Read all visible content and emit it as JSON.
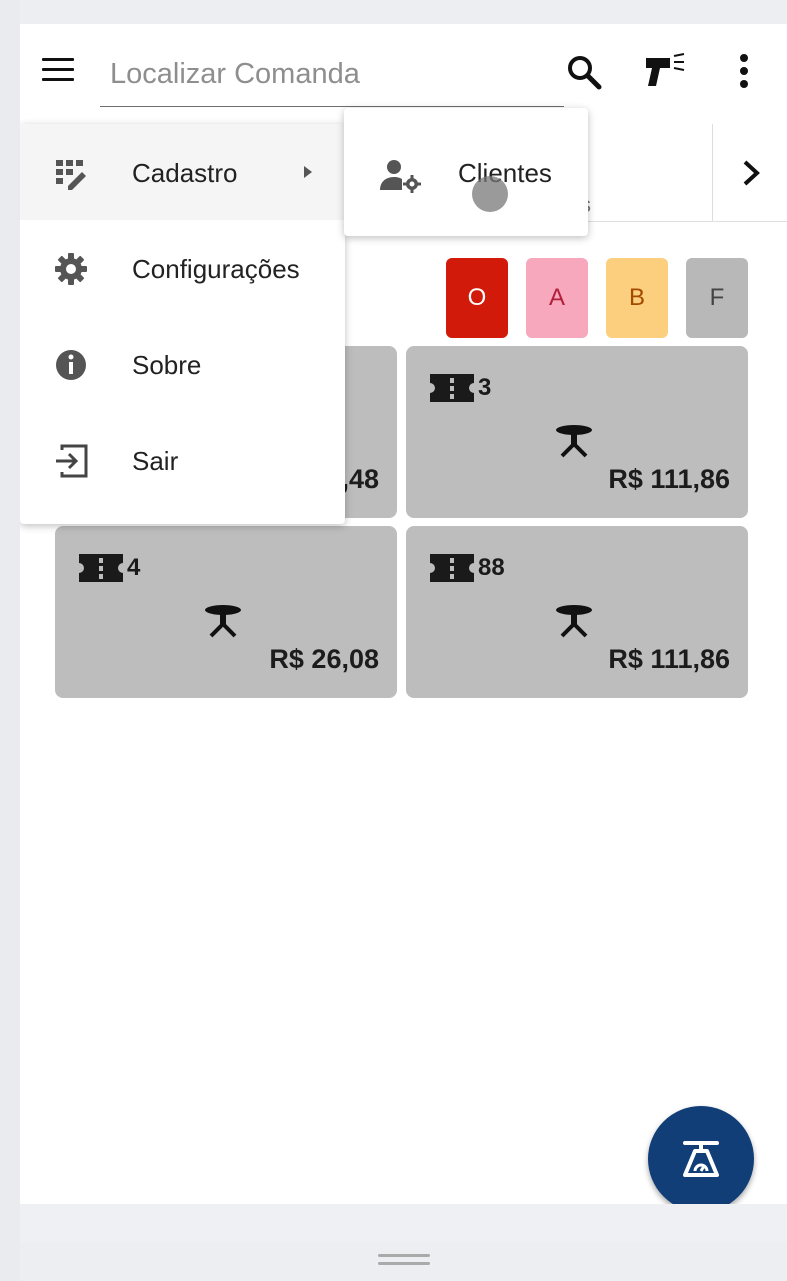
{
  "search": {
    "placeholder": "Localizar Comanda"
  },
  "icons": {
    "menu": "hamburger-icon",
    "search": "search-icon",
    "scanner": "barcode-scanner-icon",
    "more": "more-vert-icon",
    "next_tab": "chevron-right-icon",
    "fab": "scale-icon"
  },
  "filters": [
    {
      "label": "O",
      "bg": "#d11a0a",
      "fg": "#ffffff"
    },
    {
      "label": "A",
      "bg": "#f7a8bd",
      "fg": "#b0203a"
    },
    {
      "label": "B",
      "bg": "#fccf7f",
      "fg": "#a44a00"
    },
    {
      "label": "F",
      "bg": "#b8b8b8",
      "fg": "#444444"
    }
  ],
  "cards": [
    {
      "number": "",
      "price": ",48"
    },
    {
      "number": "3",
      "price": "R$ 111,86"
    },
    {
      "number": "4",
      "price": "R$ 26,08"
    },
    {
      "number": "88",
      "price": "R$ 111,86"
    }
  ],
  "menu": {
    "items": [
      {
        "label": "Cadastro",
        "icon": "dashboard-edit-icon"
      },
      {
        "label": "Configurações",
        "icon": "settings-icon"
      },
      {
        "label": "Sobre",
        "icon": "info-icon"
      },
      {
        "label": "Sair",
        "icon": "logout-icon"
      }
    ],
    "submenu": {
      "label": "Clientes",
      "icon": "manage-accounts-icon"
    }
  },
  "tab_partial_text": "s",
  "colors": {
    "fab": "#123e78",
    "card": "#bdbdbd"
  }
}
